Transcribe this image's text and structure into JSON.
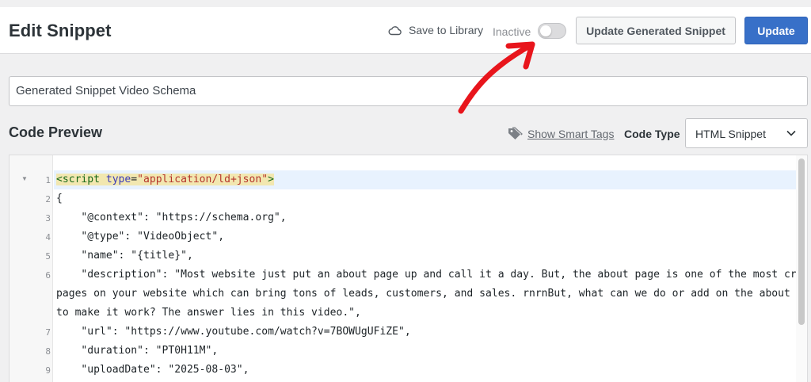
{
  "header": {
    "title": "Edit Snippet",
    "save_to_library": "Save to Library",
    "status_label": "Inactive",
    "toggle_on": false,
    "update_generated_label": "Update Generated Snippet",
    "update_label": "Update"
  },
  "snippet_title": "Generated Snippet Video Schema",
  "code_preview": {
    "heading": "Code Preview",
    "smart_tags_link": "Show Smart Tags",
    "code_type_label": "Code Type",
    "code_type_value": "HTML Snippet"
  },
  "code_lines": [
    {
      "num": "1",
      "tag_open": "<script ",
      "attr": "type",
      "eq": "=",
      "str": "\"application/ld+json\"",
      "tag_close": ">"
    },
    {
      "num": "2",
      "text": "{"
    },
    {
      "num": "3",
      "text": "    \"@context\": \"https://schema.org\","
    },
    {
      "num": "4",
      "text": "    \"@type\": \"VideoObject\","
    },
    {
      "num": "5",
      "text": "    \"name\": \"{title}\","
    },
    {
      "num": "6",
      "text": "    \"description\": \"Most website just put an about page up and call it a day. But, the about page is one of the most critical"
    },
    {
      "num": "",
      "text": "pages on your website which can bring tons of leads, customers, and sales. rnrnBut, what can we do or add on the about page"
    },
    {
      "num": "",
      "text": "to make it work? The answer lies in this video.\","
    },
    {
      "num": "7",
      "text": "    \"url\": \"https://www.youtube.com/watch?v=7BOWUgUFiZE\","
    },
    {
      "num": "8",
      "text": "    \"duration\": \"PT0H11M\","
    },
    {
      "num": "9",
      "text": "    \"uploadDate\": \"2025-08-03\","
    }
  ],
  "colors": {
    "primary_button": "#3870c8",
    "annotation_arrow": "#e8151c",
    "active_line": "#e8f2fe"
  },
  "icons": {
    "save": "cloud-icon",
    "smart_tags": "tag-icon",
    "select": "chevron-down-icon",
    "fold": "fold-triangle-icon"
  }
}
